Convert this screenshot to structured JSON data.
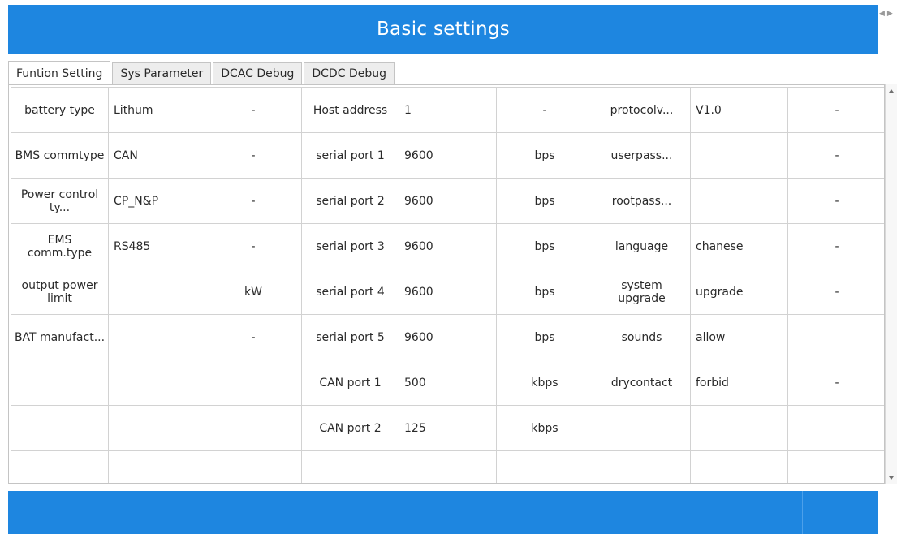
{
  "header": {
    "title": "Basic settings"
  },
  "tabs": [
    {
      "label": "Funtion Setting"
    },
    {
      "label": "Sys Parameter"
    },
    {
      "label": "DCAC Debug"
    },
    {
      "label": "DCDC Debug"
    }
  ],
  "table": {
    "rows": [
      {
        "c": [
          "battery type",
          "Lithum",
          "-",
          "Host address",
          "1",
          "-",
          "protocolv...",
          "V1.0",
          "-"
        ]
      },
      {
        "c": [
          "BMS commtype",
          "CAN",
          "-",
          "serial port 1",
          "9600",
          "bps",
          "userpass...",
          "",
          "-"
        ]
      },
      {
        "c": [
          "Power control ty...",
          "CP_N&P",
          "-",
          "serial port 2",
          "9600",
          "bps",
          "rootpass...",
          "",
          "-"
        ]
      },
      {
        "c": [
          "EMS comm.type",
          "RS485",
          "-",
          "serial port 3",
          "9600",
          "bps",
          "language",
          "chanese",
          "-"
        ]
      },
      {
        "c": [
          "output power limit",
          "",
          "kW",
          "serial port 4",
          "9600",
          "bps",
          "system upgrade",
          "upgrade",
          "-"
        ]
      },
      {
        "c": [
          "BAT manufact...",
          "",
          "-",
          "serial port 5",
          "9600",
          "bps",
          "sounds",
          "allow",
          ""
        ]
      },
      {
        "c": [
          "",
          "",
          "",
          "CAN port 1",
          "500",
          "kbps",
          "drycontact",
          "forbid",
          "-"
        ]
      },
      {
        "c": [
          "",
          "",
          "",
          "CAN port 2",
          "125",
          "kbps",
          "",
          "",
          ""
        ]
      },
      {
        "c": [
          "",
          "",
          "",
          "",
          "",
          "",
          "",
          "",
          ""
        ]
      }
    ]
  }
}
